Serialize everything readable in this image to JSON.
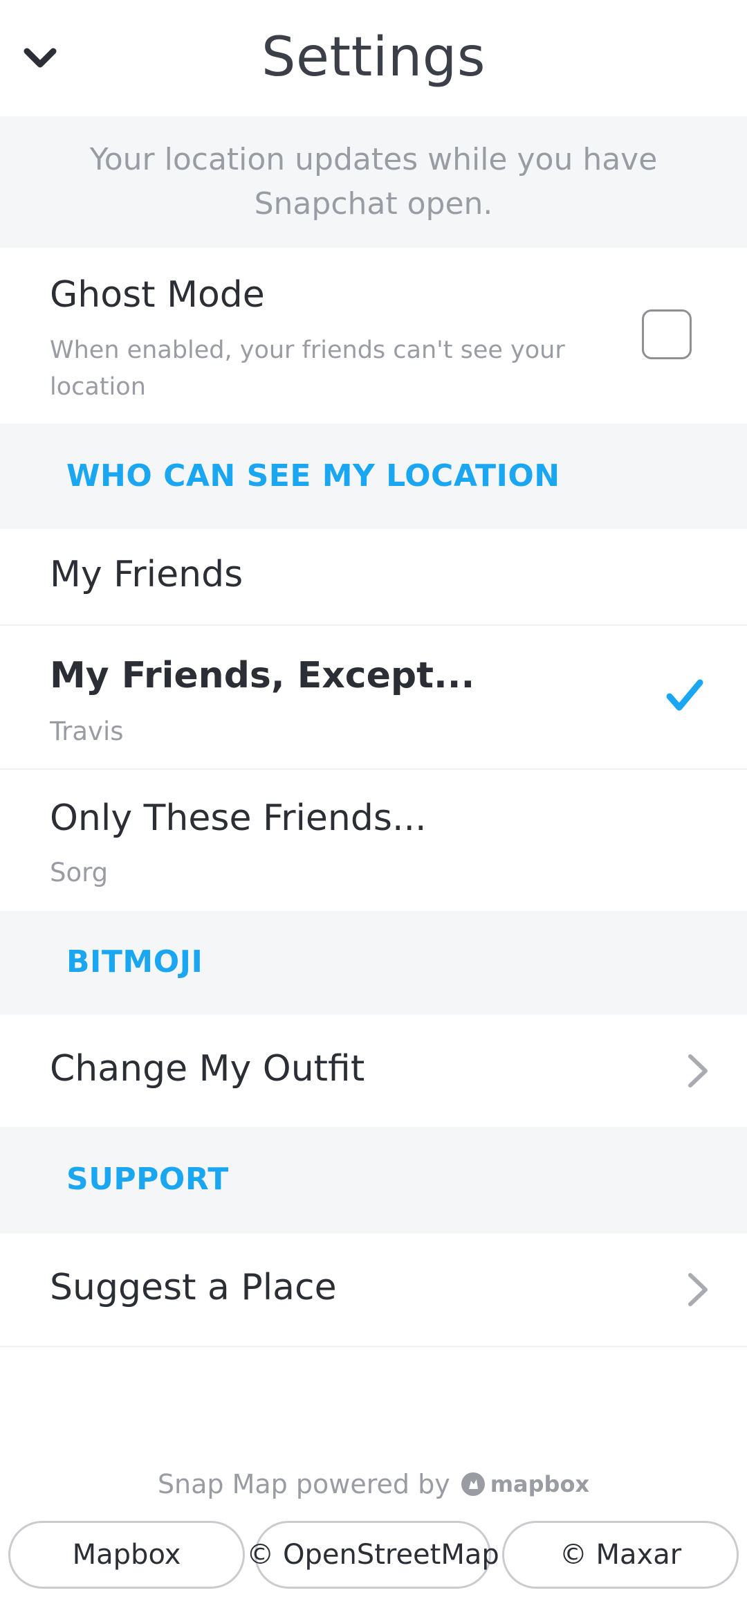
{
  "header": {
    "title": "Settings",
    "back_icon": "chevron-down-icon"
  },
  "info_banner": {
    "text": "Your location updates while you have Snapchat open."
  },
  "ghost_mode": {
    "title": "Ghost Mode",
    "description": "When enabled, your friends can't see your location",
    "checked": false
  },
  "sections": {
    "who_can_see": "WHO CAN SEE MY LOCATION",
    "bitmoji": "BITMOJI",
    "support": "SUPPORT"
  },
  "visibility_options": [
    {
      "title": "My Friends",
      "subtitle": "",
      "selected": false
    },
    {
      "title": "My Friends, Except...",
      "subtitle": "Travis",
      "selected": true
    },
    {
      "title": "Only These Friends...",
      "subtitle": "Sorg",
      "selected": false
    }
  ],
  "bitmoji": {
    "change_outfit": "Change My Outfit"
  },
  "support": {
    "suggest_place": "Suggest a Place"
  },
  "footer": {
    "powered_by": "Snap Map powered by",
    "logo_text": "mapbox",
    "attributions": [
      "Mapbox",
      "© OpenStreetMap",
      "© Maxar"
    ]
  },
  "colors": {
    "accent": "#1aa6f0",
    "section_bg": "#f5f6f8",
    "muted_text": "#9a9ca3",
    "primary_text": "#2b2e34"
  }
}
